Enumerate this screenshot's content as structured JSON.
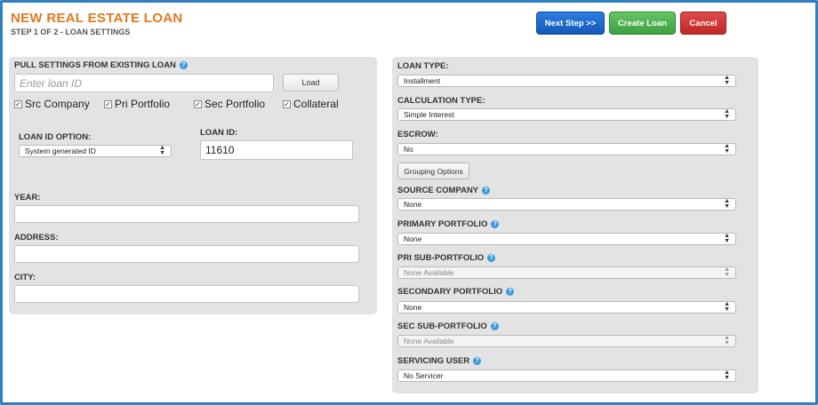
{
  "header": {
    "title": "NEW REAL ESTATE LOAN",
    "subtitle": "STEP 1 OF 2 - LOAN SETTINGS",
    "next_step_label": "Next Step >>",
    "create_loan_label": "Create Loan",
    "cancel_label": "Cancel",
    "colors": {
      "title": "#e07a1f",
      "next": "#1e6fd0",
      "create": "#4cb84c",
      "cancel": "#d43a3a"
    }
  },
  "left": {
    "pull_settings_label": "PULL SETTINGS FROM EXISTING LOAN",
    "loan_id_placeholder": "Enter loan ID",
    "load_label": "Load",
    "checkboxes": [
      {
        "label": "Src Company",
        "checked": true
      },
      {
        "label": "Pri Portfolio",
        "checked": true
      },
      {
        "label": "Sec Portfolio",
        "checked": true
      },
      {
        "label": "Collateral",
        "checked": true
      }
    ],
    "loan_id_option_label": "LOAN ID OPTION:",
    "loan_id_option_value": "System generated ID",
    "loan_id_label": "LOAN ID:",
    "loan_id_value": "11610",
    "year_label": "YEAR:",
    "year_value": "",
    "address_label": "ADDRESS:",
    "address_value": "",
    "city_label": "CITY:",
    "city_value": ""
  },
  "right": {
    "loan_type_label": "LOAN TYPE:",
    "loan_type_value": "Installment",
    "calc_type_label": "CALCULATION TYPE:",
    "calc_type_value": "Simple Interest",
    "escrow_label": "ESCROW:",
    "escrow_value": "No",
    "grouping_label": "Grouping Options",
    "source_company_label": "SOURCE COMPANY",
    "source_company_value": "None",
    "primary_portfolio_label": "PRIMARY PORTFOLIO",
    "primary_portfolio_value": "None",
    "pri_sub_label": "PRI SUB-PORTFOLIO",
    "pri_sub_value": "None Available",
    "secondary_portfolio_label": "SECONDARY PORTFOLIO",
    "secondary_portfolio_value": "None",
    "sec_sub_label": "SEC SUB-PORTFOLIO",
    "sec_sub_value": "None Available",
    "servicing_user_label": "SERVICING USER",
    "servicing_user_value": "No Servicer"
  },
  "icons": {
    "help": "help-icon",
    "check": "check-icon",
    "select_arrows": "select-arrows-icon"
  }
}
